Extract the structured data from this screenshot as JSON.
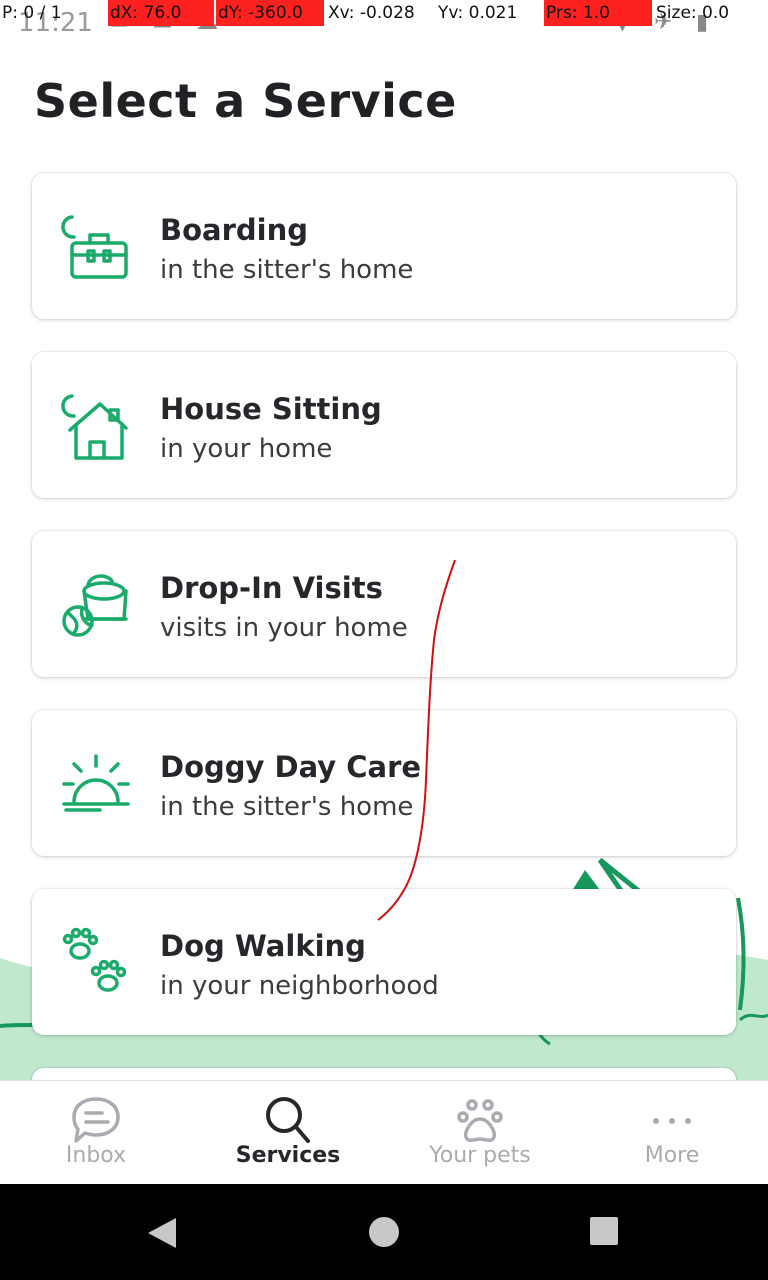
{
  "debug": {
    "pointer": "P: 0 / 1",
    "dx": "dX: 76.0",
    "dy": "dY: -360.0",
    "xv": "Xv: -0.028",
    "yv": "Yv: 0.021",
    "prs": "Prs: 1.0",
    "size": "Size: 0.0"
  },
  "status_bar": {
    "time": "11:21"
  },
  "page": {
    "title": "Select a Service"
  },
  "services": [
    {
      "title": "Boarding",
      "subtitle": "in the sitter's home",
      "icon": "boarding-icon"
    },
    {
      "title": "House Sitting",
      "subtitle": "in your home",
      "icon": "house-sitting-icon"
    },
    {
      "title": "Drop-In Visits",
      "subtitle": "visits in your home",
      "icon": "drop-in-icon"
    },
    {
      "title": "Doggy Day Care",
      "subtitle": "in the sitter's home",
      "icon": "day-care-icon"
    },
    {
      "title": "Dog Walking",
      "subtitle": "in your neighborhood",
      "icon": "dog-walking-icon"
    }
  ],
  "bottom_nav": [
    {
      "label": "Inbox",
      "icon": "chat-icon",
      "active": false
    },
    {
      "label": "Services",
      "icon": "search-icon",
      "active": true
    },
    {
      "label": "Your pets",
      "icon": "paw-icon",
      "active": false
    },
    {
      "label": "More",
      "icon": "more-icon",
      "active": false
    }
  ],
  "colors": {
    "accent": "#1aab6b",
    "decor_light": "#bfe8cd",
    "decor_dark": "#16975b",
    "trace": "#d01010"
  }
}
